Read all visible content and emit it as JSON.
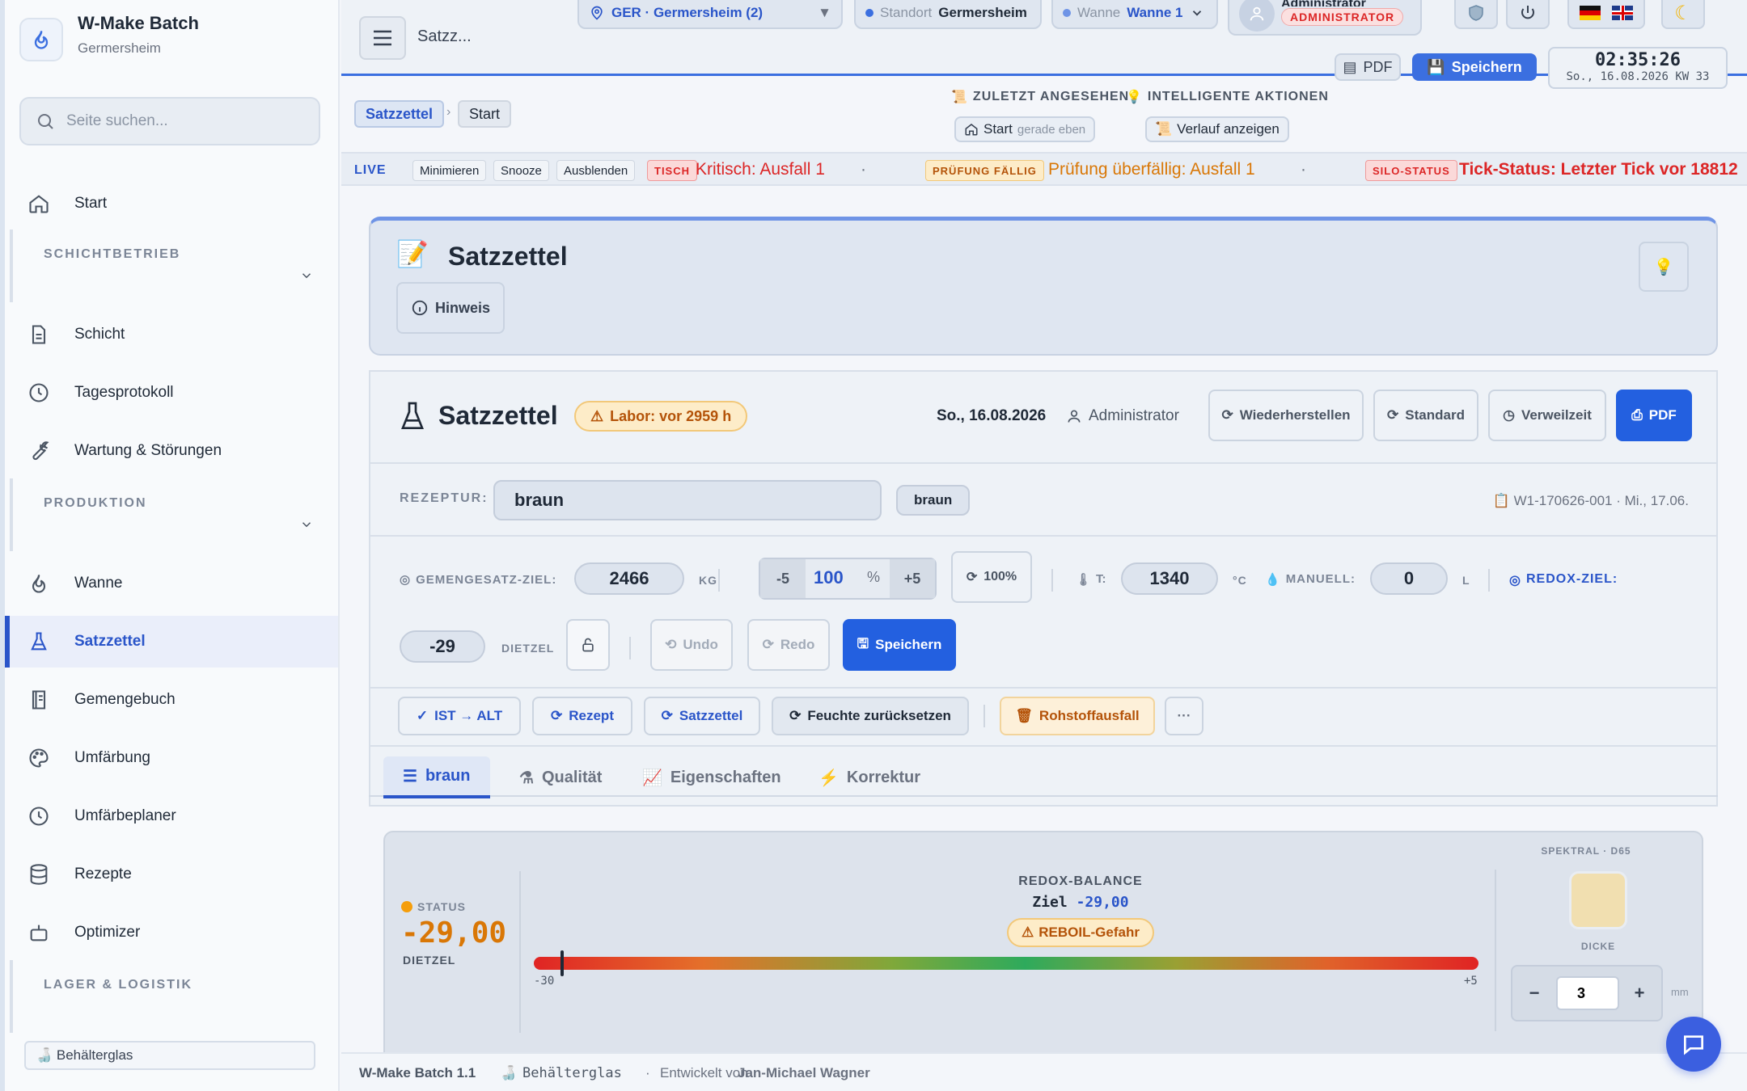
{
  "brand": {
    "title": "W-Make Batch",
    "subtitle": "Germersheim"
  },
  "search": {
    "placeholder": "Seite suchen..."
  },
  "sidebar": {
    "start": "Start",
    "section_1": "SCHICHTBETRIEB",
    "schicht": "Schicht",
    "tagesprotokoll": "Tagesprotokoll",
    "wartung": "Wartung & Störungen",
    "section_2": "PRODUKTION",
    "wanne": "Wanne",
    "satzzettel": "Satzzettel",
    "gemengebuch": "Gemengebuch",
    "umfaerbung": "Umfärbung",
    "umfaerbeplaner": "Umfärbeplaner",
    "rezepte": "Rezepte",
    "optimizer": "Optimizer",
    "section_3": "LAGER & LOGISTIK",
    "footer": "🍶 Behälterglas"
  },
  "topbar": {
    "page_short": "Satzz...",
    "site_select": "GER · Germersheim (2)",
    "standort_label": "Standort",
    "standort_value": "Germersheim",
    "wanne_label": "Wanne",
    "wanne_value": "Wanne 1",
    "user_name": "Administrator",
    "user_role": "ADMINISTRATOR",
    "pdf": "PDF",
    "save": "Speichern",
    "time": "02:35:26",
    "date": "So., 16.08.2026 KW 33"
  },
  "breadcrumb": {
    "root": "Satzzettel",
    "current": "Start"
  },
  "header_tools": {
    "recent_label": "ZULETZT ANGESEHEN",
    "smart_label": "INTELLIGENTE AKTIONEN",
    "recent_item": "Start",
    "recent_time": "gerade eben",
    "history": "Verlauf anzeigen"
  },
  "ticker": {
    "live": "LIVE",
    "minimize": "Minimieren",
    "snooze": "Snooze",
    "hide": "Ausblenden",
    "tag_1": "TISCH",
    "msg_1": "Kritisch: Ausfall 1",
    "tag_2": "PRÜFUNG FÄLLIG",
    "msg_2": "Prüfung überfällig: Ausfall 1",
    "tag_3": "SILO-STATUS",
    "msg_3": "Tick-Status: Letzter Tick vor 18812",
    "sep": "·"
  },
  "page_header": {
    "title": "Satzzettel",
    "hint": "Hinweis"
  },
  "sheet": {
    "title": "Satzzettel",
    "lab_badge": "Labor: vor 2959 h",
    "date": "So., 16.08.2026",
    "user": "Administrator",
    "restore": "Wiederherstellen",
    "standard": "Standard",
    "dwell": "Verweilzeit",
    "pdf": "PDF",
    "recipe_label": "REZEPTUR:",
    "recipe_value": "braun",
    "recipe_chip": "braun",
    "recipe_ref": "W1-170626-001 · Mi., 17.06.",
    "target_label": "GEMENGESATZ-ZIEL:",
    "target_value": "2466",
    "target_unit": "KG",
    "minus5": "-5",
    "percent_value": "100",
    "percent_unit": "%",
    "plus5": "+5",
    "reset_pct": "100%",
    "temp_label": "T:",
    "temp_value": "1340",
    "temp_unit": "°C",
    "manual_label": "MANUELL:",
    "manual_value": "0",
    "manual_unit": "L",
    "redox_label": "REDOX-ZIEL:",
    "redox_value": "-29",
    "redox_unit": "DIETZEL",
    "undo": "Undo",
    "redo": "Redo",
    "save": "Speichern"
  },
  "actions": {
    "ist_alt": "IST → ALT",
    "rezept": "Rezept",
    "satzzettel": "Satzzettel",
    "feuchte": "Feuchte zurücksetzen",
    "rohstoff": "Rohstoffausfall",
    "more": "···"
  },
  "tabs": {
    "t1": "braun",
    "t2": "Qualität",
    "t3": "Eigenschaften",
    "t4": "Korrektur"
  },
  "redox": {
    "status_label": "STATUS",
    "status_value": "-29,00",
    "status_unit": "DIETZEL",
    "balance_title": "REDOX-BALANCE",
    "target_label": "Ziel",
    "target_value": "-29,00",
    "warning": "REBOIL-Gefahr",
    "scale_min": "-30",
    "scale_max": "+5",
    "marker_value": -29,
    "spectral_label": "SPEKTRAL · D65",
    "thickness_label": "DICKE",
    "thickness_value": "3",
    "thickness_unit": "mm",
    "swatch_color": "#f1dfb0"
  },
  "statusbar": {
    "version": "W-Make Batch 1.1",
    "product": "Behälterglas",
    "dev_prefix": "Entwickelt von",
    "developer": "Jan-Michael Wagner"
  },
  "colors": {
    "accent": "#2a55c9",
    "primary_button": "#2360e0",
    "warning": "#d97706",
    "danger": "#dc2626"
  }
}
